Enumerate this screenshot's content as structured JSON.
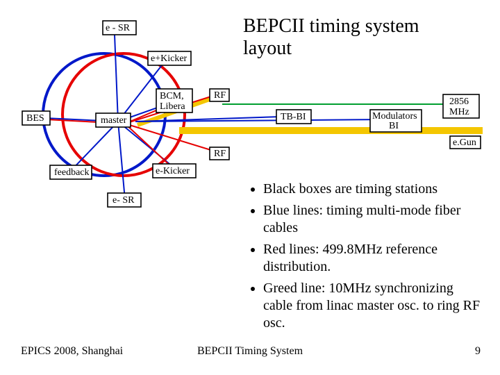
{
  "title_line1": "BEPCII timing system",
  "title_line2": "layout",
  "bullets": [
    "Black boxes are timing stations",
    "Blue lines: timing multi-mode fiber cables",
    "Red lines: 499.8MHz reference distribution.",
    "Greed line: 10MHz synchronizing cable from linac master osc. to ring RF osc."
  ],
  "diagram": {
    "e_minus_sr": "e - SR",
    "e_plus_kicker": "e+Kicker",
    "bcm_libera_line1": "BCM,",
    "bcm_libera_line2": "Libera",
    "bes": "BES",
    "master": "master",
    "rf_top": "RF",
    "tb_bi": "TB-BI",
    "modulators_line1": "Modulators",
    "modulators_line2": "BI",
    "mhz_2856_line1": "2856",
    "mhz_2856_line2": "MHz",
    "e_gun": "e.Gun",
    "feedback": "feedback",
    "e_minus_kicker": "e-Kicker",
    "e_minus_sr2": "e- SR",
    "rf_bottom": "RF"
  },
  "footer": {
    "left": "EPICS 2008, Shanghai",
    "center": "BEPCII Timing System",
    "page": "9"
  }
}
